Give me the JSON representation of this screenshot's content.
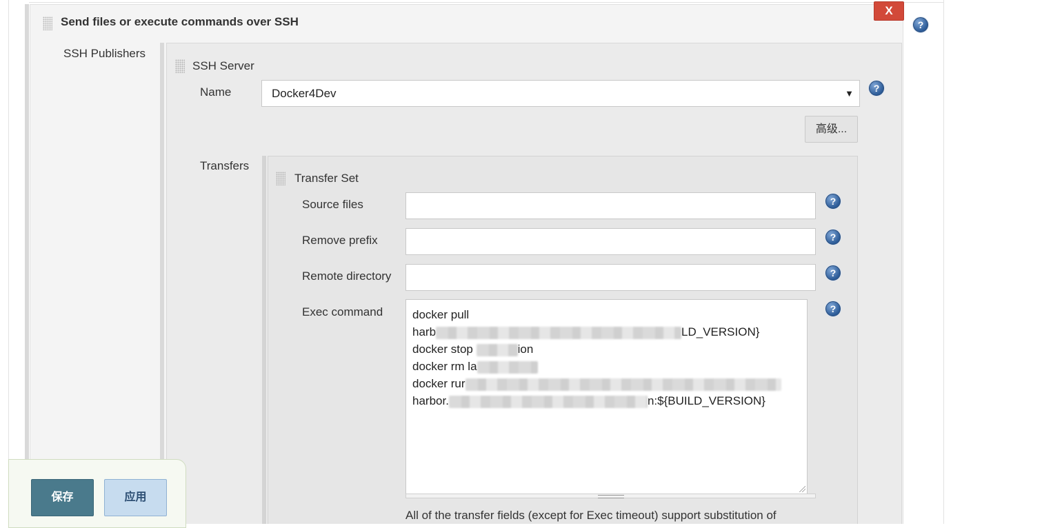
{
  "step": {
    "title": "Send files or execute commands over SSH",
    "delete_label": "X",
    "help_label": "?"
  },
  "publishers": {
    "label": "SSH Publishers",
    "server": {
      "title": "SSH Server",
      "name_label": "Name",
      "name_value": "Docker4Dev",
      "select_arrow": "▼",
      "advanced_label": "高级..."
    },
    "transfers": {
      "label": "Transfers",
      "set_title": "Transfer Set",
      "fields": {
        "source_files_label": "Source files",
        "source_files_value": "",
        "remove_prefix_label": "Remove prefix",
        "remove_prefix_value": "",
        "remote_directory_label": "Remote directory",
        "remote_directory_value": "",
        "exec_command_label": "Exec command"
      },
      "exec_command_lines": {
        "l1": "docker pull",
        "l2_start": "harb",
        "l2_end": "LD_VERSION}",
        "l3_start": "docker stop",
        "l3_end": "ion",
        "l4_start": "docker rm la",
        "l5_start": "docker rur",
        "l6_start": "harbor.",
        "l6_end": "n:${BUILD_VERSION}"
      },
      "note": "All of the transfer fields (except for Exec timeout) support substitution of"
    }
  },
  "footer": {
    "save_label": "保存",
    "apply_label": "应用"
  }
}
